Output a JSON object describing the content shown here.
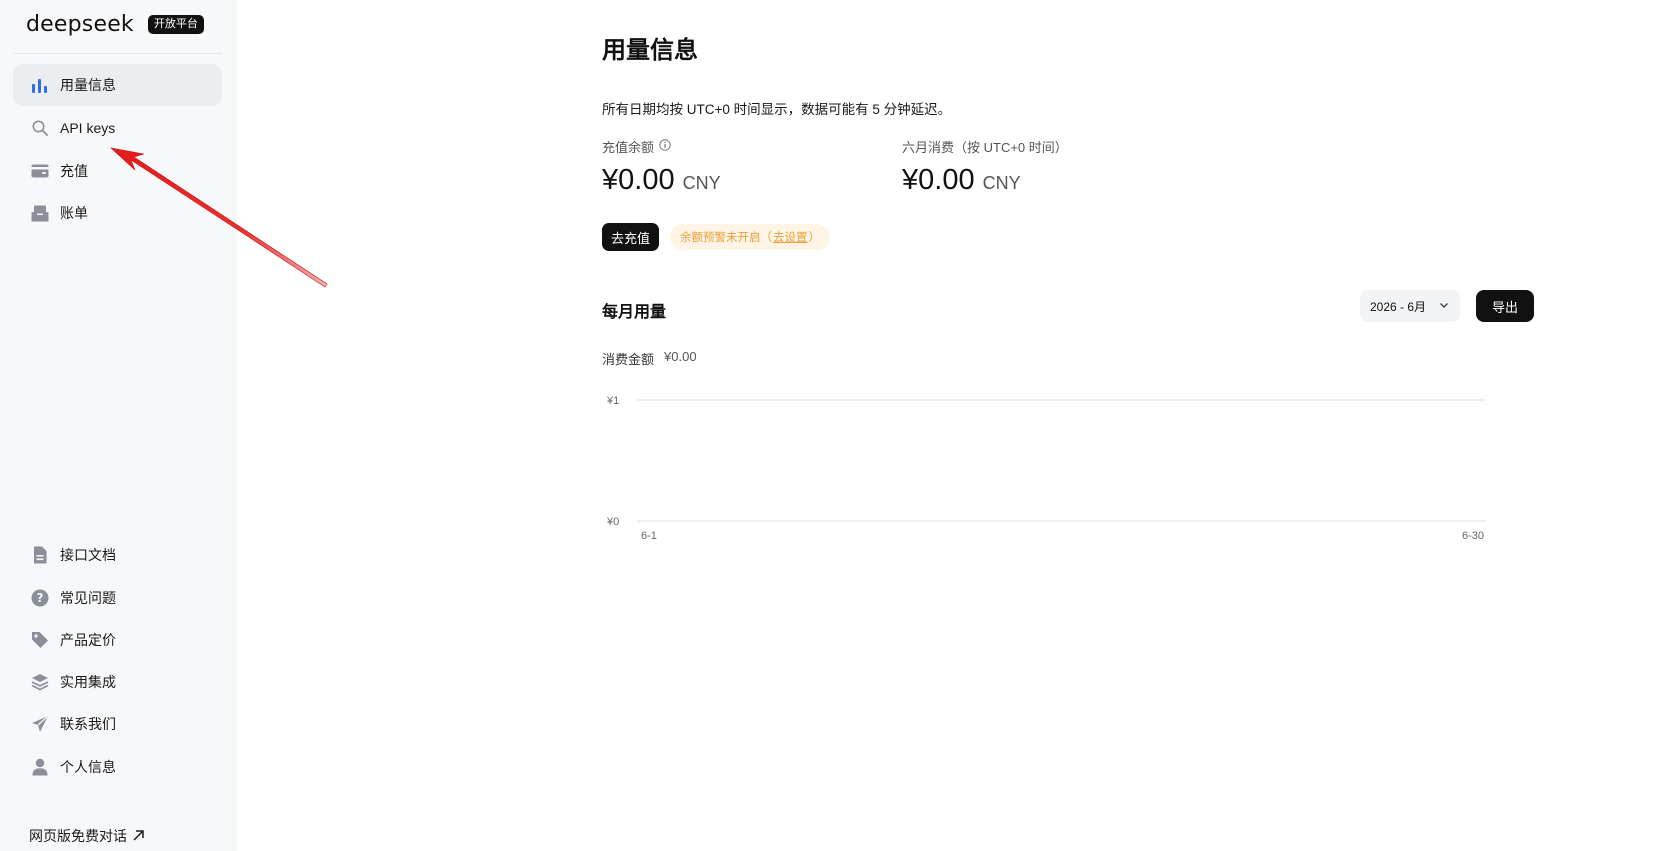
{
  "brand": {
    "logo": "deepseek",
    "badge": "开放平台"
  },
  "sidebar": {
    "top_items": [
      {
        "label": "用量信息",
        "icon": "bar-chart-icon",
        "active": true
      },
      {
        "label": "API keys",
        "icon": "search-icon",
        "active": false
      },
      {
        "label": "充值",
        "icon": "wallet-icon",
        "active": false
      },
      {
        "label": "账单",
        "icon": "inbox-icon",
        "active": false
      }
    ],
    "bottom_items": [
      {
        "label": "接口文档",
        "icon": "document-icon"
      },
      {
        "label": "常见问题",
        "icon": "question-icon"
      },
      {
        "label": "产品定价",
        "icon": "tag-icon"
      },
      {
        "label": "实用集成",
        "icon": "layers-icon"
      },
      {
        "label": "联系我们",
        "icon": "send-icon"
      },
      {
        "label": "个人信息",
        "icon": "user-icon"
      }
    ],
    "web_link": "网页版免费对话"
  },
  "main": {
    "title": "用量信息",
    "notice": "所有日期均按 UTC+0 时间显示，数据可能有 5 分钟延迟。",
    "balance": {
      "label": "充值余额",
      "amount": "¥0.00",
      "unit": "CNY"
    },
    "monthly_spend": {
      "label": "六月消费（按 UTC+0 时间）",
      "amount": "¥0.00",
      "unit": "CNY"
    },
    "recharge_button": "去充值",
    "alert": {
      "prefix": "余额预警未开启（",
      "link": "去设置",
      "suffix": "）"
    },
    "usage_title": "每月用量",
    "month_select": "2026 - 6月",
    "export_button": "导出",
    "spend_label": "消费金额",
    "spend_value": "¥0.00"
  },
  "colors": {
    "accent": "#111111",
    "active_bg": "#ebedf0",
    "warning": "#e8a13a",
    "warning_bg": "#fff4e5",
    "annotation": "#e31b1b"
  },
  "chart_data": {
    "type": "line",
    "x": [
      "6-1",
      "6-30"
    ],
    "y_ticks": [
      "¥0",
      "¥1"
    ],
    "ylim": [
      0,
      1
    ],
    "series": [],
    "grid": true
  }
}
